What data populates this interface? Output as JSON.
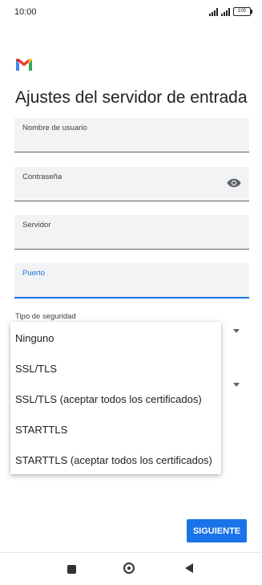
{
  "status_bar": {
    "time": "10:00",
    "battery": "100"
  },
  "page": {
    "title": "Ajustes del servidor de entrada"
  },
  "fields": {
    "username": {
      "label": "Nombre de usuario"
    },
    "password": {
      "label": "Contraseña"
    },
    "server": {
      "label": "Servidor"
    },
    "port": {
      "label": "Puerto"
    }
  },
  "security": {
    "label": "Tipo de seguridad",
    "options": [
      "Ninguno",
      "SSL/TLS",
      "SSL/TLS (aceptar todos los certificados)",
      "STARTTLS",
      "STARTTLS (aceptar todos los certificados)"
    ]
  },
  "actions": {
    "next_label": "SIGUIENTE"
  },
  "colors": {
    "accent": "#1a73e8",
    "field_bg": "#f1f3f4"
  }
}
